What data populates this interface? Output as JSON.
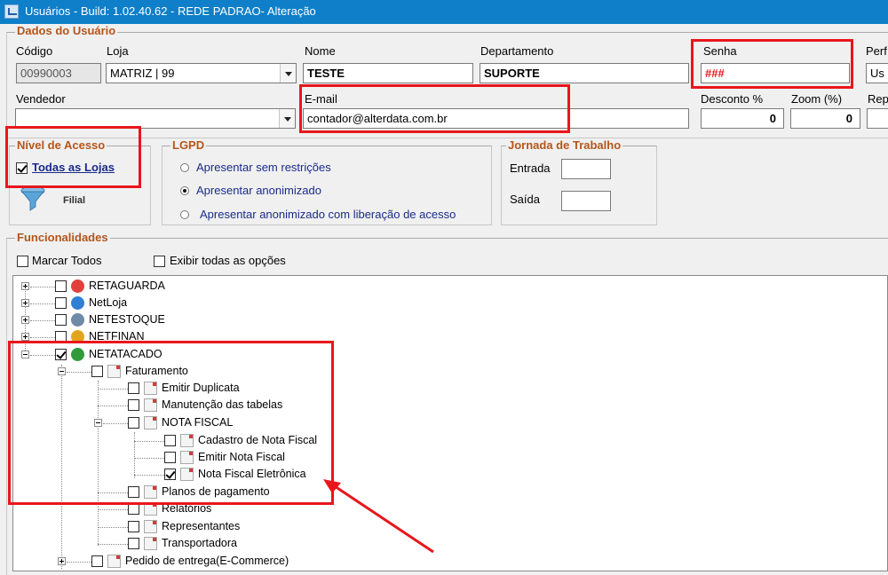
{
  "window": {
    "title": "Usuários - Build: 1.02.40.62 - REDE PADRAO- Alteração"
  },
  "dados": {
    "group_title": "Dados do Usuário",
    "codigo_label": "Código",
    "codigo_value": "00990003",
    "loja_label": "Loja",
    "loja_value": "MATRIZ | 99",
    "nome_label": "Nome",
    "nome_value": "TESTE",
    "departamento_label": "Departamento",
    "departamento_value": "SUPORTE",
    "senha_label": "Senha",
    "senha_value": "###",
    "perfil_label": "Perf",
    "perfil_value": "Us",
    "vendedor_label": "Vendedor",
    "vendedor_value": "",
    "email_label": "E-mail",
    "email_value": "contador@alterdata.com.br",
    "desconto_label": "Desconto %",
    "desconto_value": "0",
    "zoom_label": "Zoom (%)",
    "zoom_value": "0",
    "rep_label": "Rep"
  },
  "nivel": {
    "group_title": "Nível de Acesso",
    "todas_lojas": "Todas as Lojas",
    "todas_lojas_checked": true,
    "filial_label": "Filial"
  },
  "lgpd": {
    "group_title": "LGPD",
    "options": [
      "Apresentar sem restrições",
      "Apresentar anonimizado",
      "Apresentar anonimizado com liberação de acesso"
    ],
    "selected": 1
  },
  "jornada": {
    "group_title": "Jornada de Trabalho",
    "entrada_label": "Entrada",
    "saida_label": "Saída"
  },
  "funcionalidades": {
    "group_title": "Funcionalidades",
    "marcar_todos": "Marcar Todos",
    "exibir_todas": "Exibir todas as opções",
    "tree": [
      {
        "label": "RETAGUARDA",
        "checked": false,
        "badge_color": "#e0413b"
      },
      {
        "label": "NetLoja",
        "checked": false,
        "badge_color": "#2f7fd4"
      },
      {
        "label": "NETESTOQUE",
        "checked": false,
        "badge_color": "#6f8aa6"
      },
      {
        "label": "NETFINAN",
        "checked": false,
        "badge_color": "#e2a41e"
      },
      {
        "label": "NETATACADO",
        "checked": true,
        "badge_color": "#2f9b3a"
      },
      {
        "label": "Faturamento",
        "checked": false
      },
      {
        "label": "Emitir Duplicata",
        "checked": false
      },
      {
        "label": "Manutenção das tabelas",
        "checked": false
      },
      {
        "label": "NOTA FISCAL",
        "checked": false
      },
      {
        "label": "Cadastro de Nota Fiscal",
        "checked": false
      },
      {
        "label": "Emitir Nota Fiscal",
        "checked": false
      },
      {
        "label": "Nota Fiscal Eletrônica",
        "checked": true
      },
      {
        "label": "Planos de pagamento",
        "checked": false
      },
      {
        "label": "Relatórios",
        "checked": false
      },
      {
        "label": "Representantes",
        "checked": false
      },
      {
        "label": "Transportadora",
        "checked": false
      },
      {
        "label": "Pedido de entrega(E-Commerce)",
        "checked": false
      }
    ]
  },
  "colors": {
    "titlebar": "#0e7fc8",
    "group_title": "#b5551a",
    "highlight": "#e8161c"
  }
}
